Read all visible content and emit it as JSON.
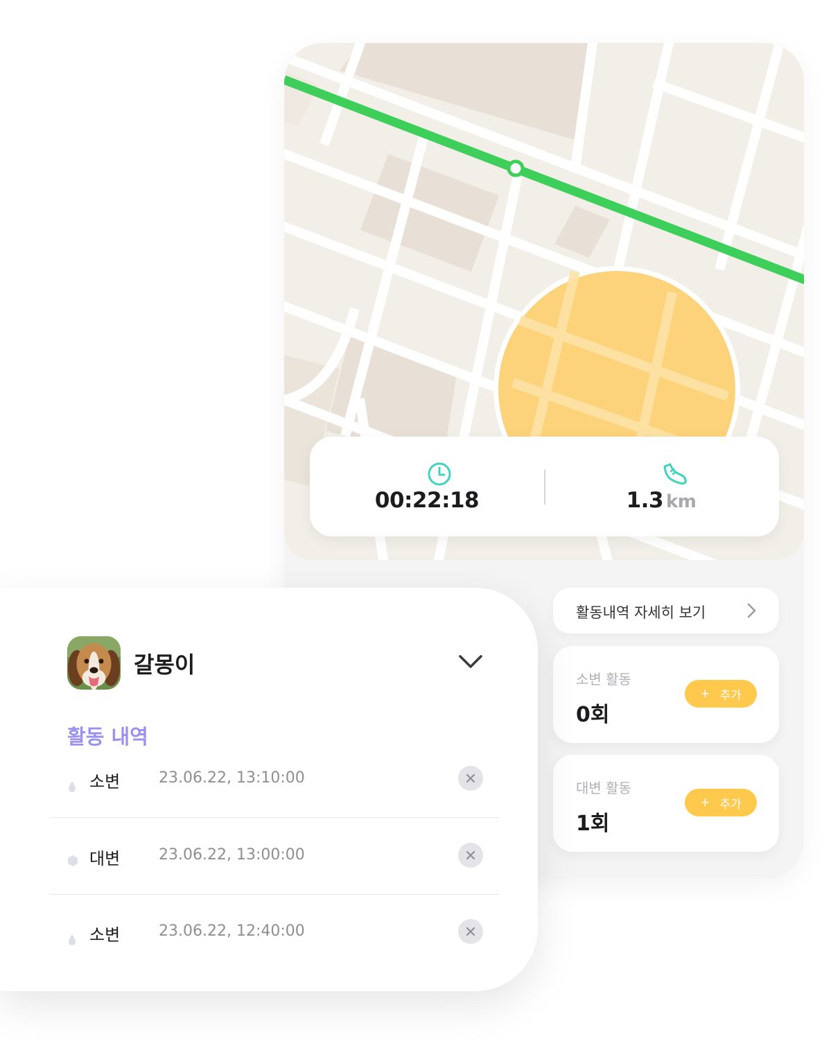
{
  "tracking": {
    "elapsed_time": "00:22:18",
    "distance_value": "1.3",
    "distance_unit": "km"
  },
  "detail_link": {
    "label": "활동내역 자세히 보기"
  },
  "activity_cards": [
    {
      "title": "소변 활동",
      "count": "0회",
      "add_label": "추가"
    },
    {
      "title": "대변 활동",
      "count": "1회",
      "add_label": "추가"
    }
  ],
  "pet": {
    "name": "갈몽이"
  },
  "history": {
    "title": "활동 내역",
    "items": [
      {
        "type": "소변",
        "time": "23.06.22, 13:10:00"
      },
      {
        "type": "대변",
        "time": "23.06.22, 13:00:00"
      },
      {
        "type": "소변",
        "time": "23.06.22, 12:40:00"
      }
    ]
  },
  "colors": {
    "route": "#3ecf5a",
    "area": "#fcd37a",
    "accent_purple": "#9b91f0",
    "add_button": "#ffc94d",
    "clock_icon": "#3fd3c0"
  },
  "icons": {
    "time": "clock-icon",
    "distance": "shoe-icon",
    "urine": "drop-icon",
    "feces": "hexagon-icon",
    "delete": "close-icon",
    "expand": "chevron-down-icon",
    "more": "chevron-right-icon"
  }
}
